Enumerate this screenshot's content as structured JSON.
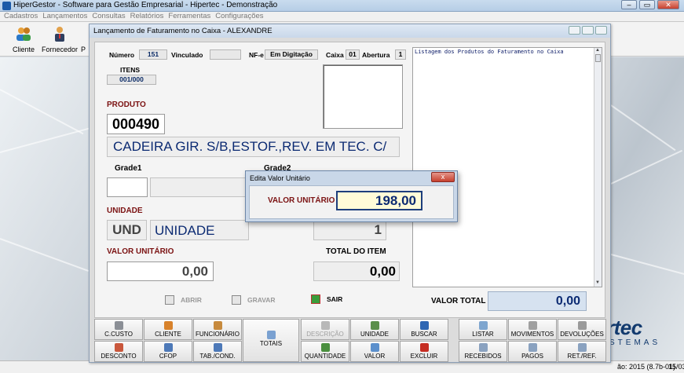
{
  "app": {
    "title": "HiperGestor - Software para Gestão Empresarial - Hipertec - Demonstração",
    "menu": [
      "Cadastros",
      "Lançamentos",
      "Consultas",
      "Relatórios",
      "Ferramentas",
      "Configurações"
    ],
    "toolbar": [
      {
        "label": "Cliente",
        "icon": "users-icon"
      },
      {
        "label": "Fornecedor",
        "icon": "supplier-icon"
      },
      {
        "label": "P",
        "icon": "product-icon"
      }
    ],
    "logo": {
      "main": "rtec",
      "sub": "STEMAS"
    },
    "status": {
      "version": "ão: 2015 (8.7b-01)",
      "date": "15/03"
    }
  },
  "window": {
    "title": "Lançamento de Faturamento no Caixa - ALEXANDRE",
    "header": {
      "numero_label": "Número",
      "numero": "151",
      "vinculado_label": "Vinculado",
      "vinculado": "",
      "nfe_label": "NF-e",
      "nfe_status": "Em Digitação",
      "caixa_label": "Caixa",
      "caixa": "01",
      "abertura_label": "Abertura",
      "abertura": "1"
    },
    "itens_label": "ITENS",
    "itens": "001/000",
    "produto_label": "PRODUTO",
    "produto_codigo": "000490",
    "produto_descricao": "CADEIRA GIR. S/B,ESTOF.,REV. EM TEC. C/",
    "grade1_label": "Grade1",
    "grade2_label": "Grade2",
    "grade1_value": "",
    "grade1_desc": "",
    "unidade_label": "UNIDADE",
    "unidade_codigo": "UND",
    "unidade_descricao": "UNIDADE",
    "quantidade": "1",
    "valor_unitario_label": "VALOR UNITÁRIO",
    "valor_unitario": "0,00",
    "total_item_label": "TOTAL DO ITEM",
    "total_item": "0,00",
    "listing_title": "Listagem dos Produtos do Faturamento no Caixa",
    "actions": {
      "abrir": "ABRIR",
      "gravar": "GRAVAR",
      "sair": "SAIR"
    },
    "valor_total_label": "VALOR TOTAL",
    "valor_total": "0,00",
    "buttons": {
      "ccusto": "C.CUSTO",
      "cliente": "CLIENTE",
      "funcionario": "FUNCIONÁRIO",
      "totais": "TOTAIS",
      "descricao": "DESCRIÇÃO",
      "unidade": "UNIDADE",
      "buscar": "BUSCAR",
      "listar": "LISTAR",
      "movimentos": "MOVIMENTOS",
      "devolucoes": "DEVOLUÇÕES",
      "desconto": "DESCONTO",
      "cfop": "CFOP",
      "tabcond": "TAB./COND.",
      "quantidade": "QUANTIDADE",
      "valor": "VALOR",
      "excluir": "EXCLUIR",
      "recebidos": "RECEBIDOS",
      "pagos": "PAGOS",
      "retref": "RET./REF."
    }
  },
  "modal": {
    "title": "Edita Valor Unitário",
    "label": "VALOR UNITÁRIO",
    "value": "198,00",
    "close": "x"
  },
  "colors": {
    "accent": "#0b2a72",
    "label_red": "#7b1212",
    "modal_bg": "#c9d7e8"
  }
}
